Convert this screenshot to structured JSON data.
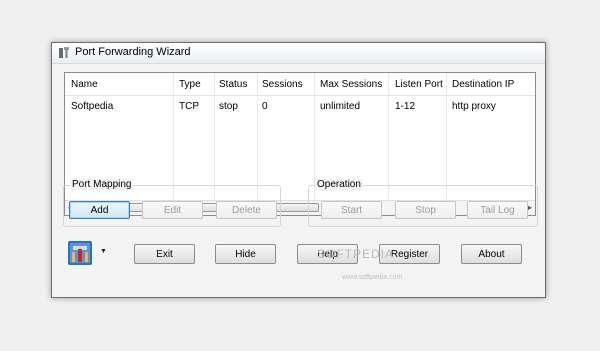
{
  "window": {
    "title": "Port Forwarding Wizard"
  },
  "table": {
    "columns": [
      "Name",
      "Type",
      "Status",
      "Sessions",
      "Max Sessions",
      "Listen Port",
      "Destination IP"
    ],
    "rows": [
      [
        "Softpedia",
        "TCP",
        "stop",
        "0",
        "unlimited",
        "1-12",
        "http proxy"
      ]
    ],
    "scroll_thumb_glyph": "III"
  },
  "port_mapping": {
    "label": "Port Mapping",
    "add_label": "Add",
    "edit_label": "Edit",
    "delete_label": "Delete"
  },
  "operation": {
    "label": "Operation",
    "start_label": "Start",
    "stop_label": "Stop",
    "taillog_label": "Tail Log"
  },
  "bottom": {
    "exit_label": "Exit",
    "hide_label": "Hide",
    "help_label": "Help",
    "register_label": "Register",
    "about_label": "About"
  },
  "watermark": {
    "text": "SOFTPEDIA",
    "sub": "www.softpedia.com"
  },
  "icons": {
    "app": "tools-icon",
    "logo": "port-wizard-logo-icon"
  }
}
